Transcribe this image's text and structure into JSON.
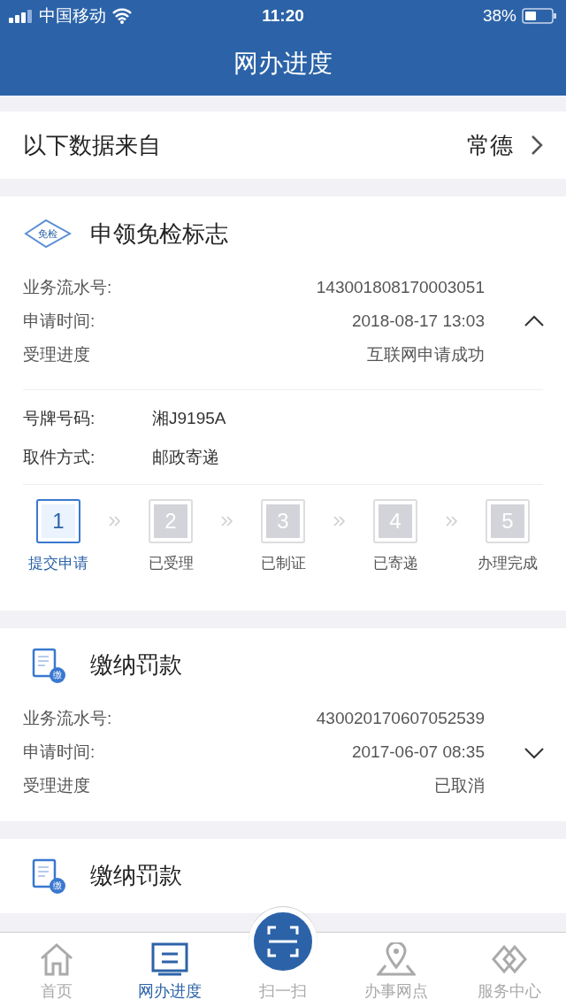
{
  "status_bar": {
    "carrier": "中国移动",
    "time": "11:20",
    "battery": "38%"
  },
  "header": {
    "title": "网办进度"
  },
  "source": {
    "label": "以下数据来自",
    "city": "常德"
  },
  "cards": [
    {
      "kind": "inspection",
      "icon_text": "免检",
      "title": "申领免检标志",
      "expanded": true,
      "rows": [
        {
          "label": "业务流水号:",
          "value": "143001808170003051"
        },
        {
          "label": "申请时间:",
          "value": "2018-08-17 13:03"
        },
        {
          "label": "受理进度",
          "value": "互联网申请成功"
        }
      ],
      "details": [
        {
          "label": "号牌号码:",
          "value": "湘J9195A"
        },
        {
          "label": "取件方式:",
          "value": "邮政寄递"
        }
      ],
      "steps": [
        {
          "number": "1",
          "label": "提交申请",
          "active": true
        },
        {
          "number": "2",
          "label": "已受理",
          "active": false
        },
        {
          "number": "3",
          "label": "已制证",
          "active": false
        },
        {
          "number": "4",
          "label": "已寄递",
          "active": false
        },
        {
          "number": "5",
          "label": "办理完成",
          "active": false
        }
      ]
    },
    {
      "kind": "fine",
      "icon_text": "缴",
      "title": "缴纳罚款",
      "expanded": false,
      "rows": [
        {
          "label": "业务流水号:",
          "value": "430020170607052539"
        },
        {
          "label": "申请时间:",
          "value": "2017-06-07 08:35"
        },
        {
          "label": "受理进度",
          "value": "已取消"
        }
      ]
    },
    {
      "kind": "fine",
      "icon_text": "缴",
      "title": "缴纳罚款"
    }
  ],
  "tabs": [
    {
      "kind": "home",
      "label": "首页",
      "selected": false
    },
    {
      "kind": "progress",
      "label": "网办进度",
      "selected": true
    },
    {
      "kind": "scan",
      "label": "扫一扫",
      "selected": false
    },
    {
      "kind": "location",
      "label": "办事网点",
      "selected": false
    },
    {
      "kind": "service",
      "label": "服务中心",
      "selected": false
    }
  ]
}
